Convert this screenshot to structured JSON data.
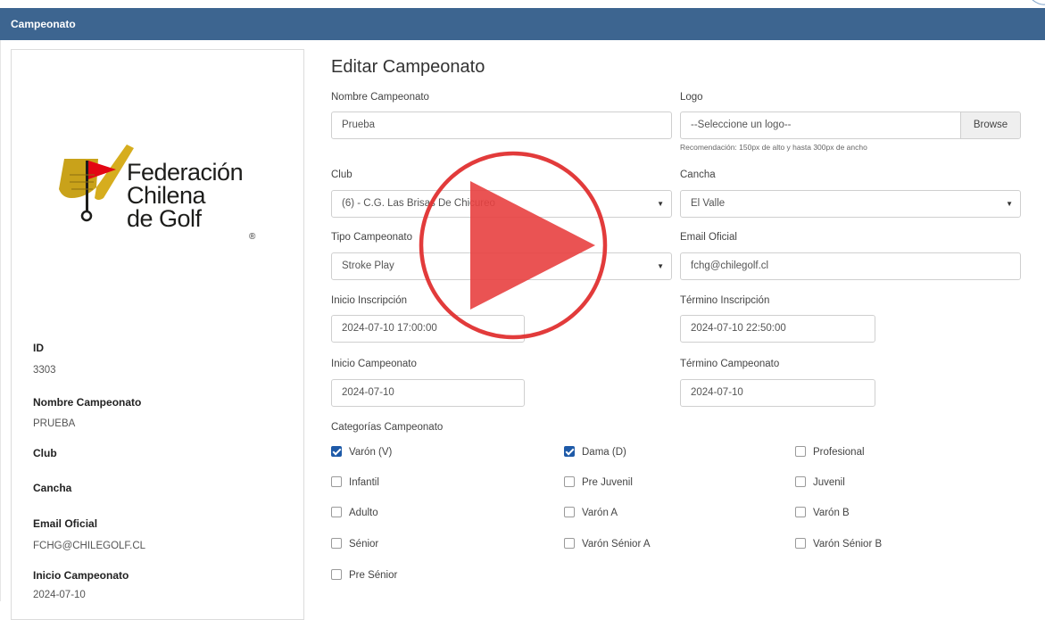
{
  "header": {
    "title": "Campeonato"
  },
  "logo": {
    "line1": "Federación",
    "line2": "Chilena",
    "line3": "de Golf",
    "reg": "®"
  },
  "sidebar": {
    "fields": [
      {
        "label": "ID",
        "value": "3303"
      },
      {
        "label": "Nombre Campeonato",
        "value": "PRUEBA"
      },
      {
        "label": "Club",
        "value": ""
      },
      {
        "label": "Cancha",
        "value": ""
      },
      {
        "label": "Email Oficial",
        "value": "FCHG@CHILEGOLF.CL"
      },
      {
        "label": "Inicio Campeonato",
        "value": "2024-07-10"
      }
    ]
  },
  "form": {
    "title": "Editar Campeonato",
    "nombre": {
      "label": "Nombre Campeonato",
      "value": "Prueba"
    },
    "logo": {
      "label": "Logo",
      "value": "--Seleccione un logo--",
      "browse": "Browse",
      "hint": "Recomendación: 150px de alto y hasta 300px de ancho"
    },
    "club": {
      "label": "Club",
      "value": "(6) - C.G. Las Brisas De Chicureo"
    },
    "cancha": {
      "label": "Cancha",
      "value": "El Valle"
    },
    "tipo": {
      "label": "Tipo Campeonato",
      "value": "Stroke Play"
    },
    "email": {
      "label": "Email Oficial",
      "value": "fchg@chilegolf.cl"
    },
    "inicio_inscripcion": {
      "label": "Inicio Inscripción",
      "value": "2024-07-10 17:00:00"
    },
    "termino_inscripcion": {
      "label": "Término Inscripción",
      "value": "2024-07-10 22:50:00"
    },
    "inicio_campeonato": {
      "label": "Inicio Campeonato",
      "value": "2024-07-10"
    },
    "termino_campeonato": {
      "label": "Término Campeonato",
      "value": "2024-07-10"
    },
    "categorias": {
      "label": "Categorías Campeonato",
      "items": [
        {
          "label": "Varón (V)",
          "checked": true
        },
        {
          "label": "Dama (D)",
          "checked": true
        },
        {
          "label": "Profesional",
          "checked": false
        },
        {
          "label": "Infantil",
          "checked": false
        },
        {
          "label": "Pre Juvenil",
          "checked": false
        },
        {
          "label": "Juvenil",
          "checked": false
        },
        {
          "label": "Adulto",
          "checked": false
        },
        {
          "label": "Varón A",
          "checked": false
        },
        {
          "label": "Varón B",
          "checked": false
        },
        {
          "label": "Sénior",
          "checked": false
        },
        {
          "label": "Varón Sénior A",
          "checked": false
        },
        {
          "label": "Varón Sénior B",
          "checked": false
        },
        {
          "label": "Pre Sénior",
          "checked": false
        }
      ]
    }
  },
  "colors": {
    "header": "#3d6590",
    "checkbox_checked": "#1e5aa8",
    "play_overlay": "#e03030"
  },
  "icons": {
    "play": "play-icon",
    "dropdown": "caret-down-icon",
    "checkbox": "checkbox-icon"
  }
}
